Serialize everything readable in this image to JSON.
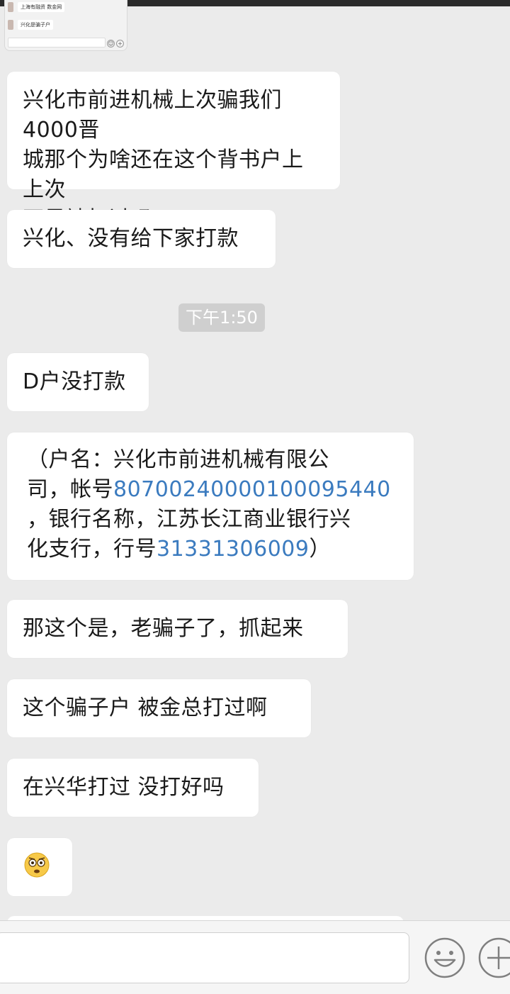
{
  "thumbnail": {
    "row1": "上海有融资 数金网",
    "row2": "兴化是骗子户"
  },
  "messages": [
    {
      "id": "msg1",
      "text_lines": [
        "兴化市前进机械上次骗我们4000晋",
        "城那个为啥还在这个背书户上 上次",
        "不是被打过吗"
      ]
    },
    {
      "id": "msg2",
      "text": "兴化、没有给下家打款"
    },
    {
      "id": "timestamp",
      "text": "下午1:50"
    },
    {
      "id": "msg3",
      "text": "D户没打款"
    },
    {
      "id": "msg4",
      "line1": "（户名：兴化市前进机械有限公",
      "line2_prefix": "司，帐号",
      "account_number": "8070024000010009544​0",
      "line3": "，银行名称，江苏长江商业银行兴",
      "line4_prefix": "化支行，行号",
      "bank_code": "31331306009",
      "line4_suffix": "）"
    },
    {
      "id": "msg5",
      "text": "那这个是，老骗子了，抓起来"
    },
    {
      "id": "msg6",
      "text": "这个骗子户 被金总打过啊"
    },
    {
      "id": "msg7",
      "text": "在兴华打过 没打好吗"
    },
    {
      "id": "msg8",
      "emoji": "shocked-face-emoji"
    }
  ],
  "input_bar": {
    "text_value": "",
    "emoji_button": "smiley-icon",
    "more_button": "plus-icon"
  },
  "colors": {
    "background": "#ebebeb",
    "bubble": "#ffffff",
    "link": "#3b7bbf",
    "timestamp_bg": "#cfcfcf"
  }
}
